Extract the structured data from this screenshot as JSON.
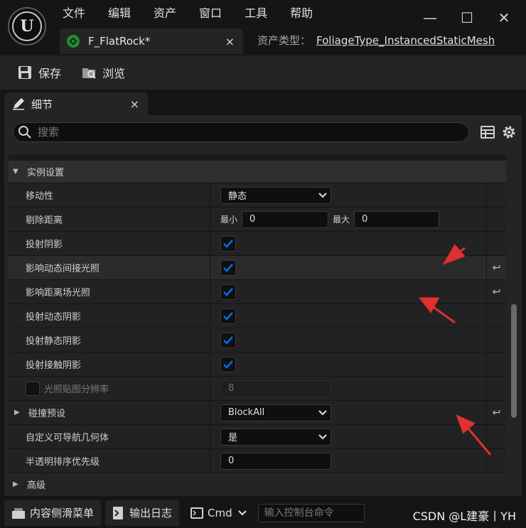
{
  "menu": [
    "文件",
    "编辑",
    "资产",
    "窗口",
    "工具",
    "帮助"
  ],
  "window": {
    "minimize": "—",
    "maximize": "☐",
    "close": "✕"
  },
  "doc_tab": {
    "label": "F_FlatRock*",
    "close": "×"
  },
  "asset_type": {
    "label": "资产类型：",
    "value": "FoliageType_InstancedStaticMesh"
  },
  "toolbar": {
    "save_label": "保存",
    "browse_label": "浏览"
  },
  "details": {
    "tab_label": "细节",
    "tab_close": "×",
    "search_placeholder": "搜索",
    "category": "实例设置",
    "mobility": {
      "label": "移动性",
      "value": "静态"
    },
    "cull_distance": {
      "label": "剔除距离",
      "min_label": "最小",
      "min_value": "0",
      "max_label": "最大",
      "max_value": "0"
    },
    "cast_shadow": {
      "label": "投射阴影"
    },
    "affect_dynamic_gi": {
      "label": "影响动态间接光照"
    },
    "affect_distance_field": {
      "label": "影响距离场光照"
    },
    "cast_dynamic_shadow": {
      "label": "投射动态阴影"
    },
    "cast_static_shadow": {
      "label": "投射静态阴影"
    },
    "cast_contact_shadow": {
      "label": "投射接触阴影"
    },
    "lightmap_res": {
      "label": "光照贴图分辨率",
      "value": "8"
    },
    "collision": {
      "label": "碰撞预设",
      "value": "BlockAll"
    },
    "custom_nav": {
      "label": "自定义可导航几何体",
      "value": "是"
    },
    "translucency": {
      "label": "半透明排序优先级",
      "value": "0"
    },
    "advanced": {
      "label": "高级"
    }
  },
  "statusbar": {
    "content_drawer": "内容侧滑菜单",
    "output_log": "输出日志",
    "cmd": "Cmd",
    "console_placeholder": "输入控制台命令"
  },
  "watermark": "CSDN @L建豪丨YH",
  "colors": {
    "accent": "#0070e0",
    "annotation": "#e03030"
  }
}
